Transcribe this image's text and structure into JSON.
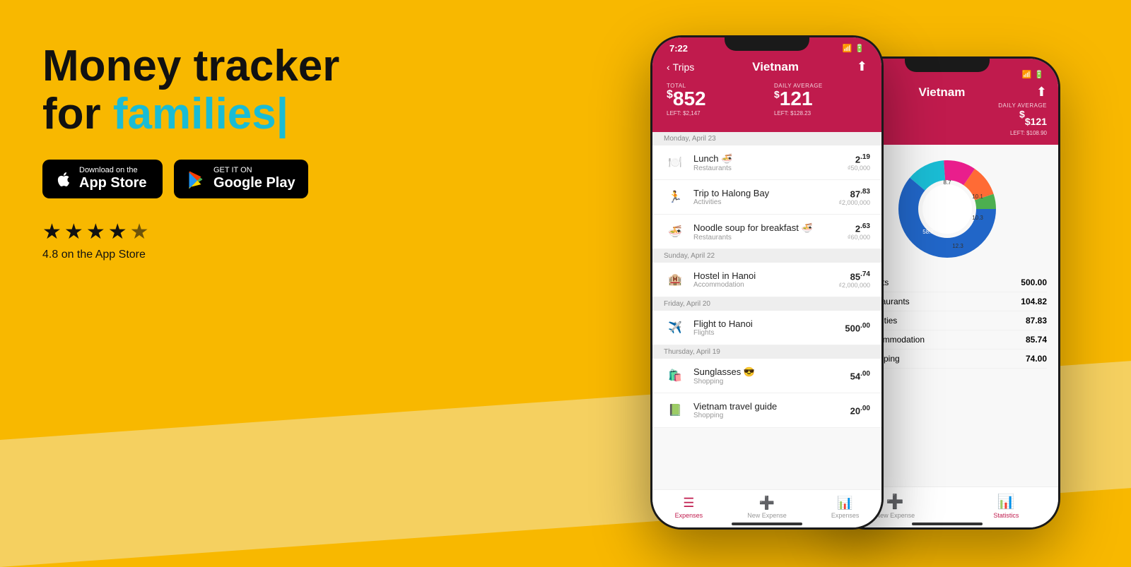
{
  "background_color": "#F8B800",
  "headline": {
    "line1": "Money tracker",
    "line2_prefix": "for ",
    "line2_highlight": "families",
    "cursor": "|"
  },
  "buttons": {
    "app_store": {
      "top_text": "Download on the",
      "main_text": "App Store"
    },
    "google_play": {
      "top_text": "GET IT ON",
      "main_text": "Google Play"
    }
  },
  "rating": {
    "stars": 4.8,
    "label": "4.8 on the App Store"
  },
  "phone_front": {
    "status_time": "7:22",
    "nav_back": "Trips",
    "nav_title": "Vietnam",
    "total_label": "TOTAL",
    "total_value": "$852",
    "total_left": "LEFT: $2,147",
    "daily_avg_label": "DAILY AVERAGE",
    "daily_avg_value": "$121",
    "daily_avg_left": "LEFT: $128.23",
    "sections": [
      {
        "date": "Monday, April 23",
        "items": [
          {
            "icon": "🍽️",
            "name": "Lunch 🍜",
            "category": "Restaurants",
            "amount": "2",
            "decimal": "19",
            "local": "₫50,000"
          },
          {
            "icon": "🏃",
            "name": "Trip to Halong Bay",
            "category": "Activities",
            "amount": "87",
            "decimal": "83",
            "local": "₫2,000,000"
          },
          {
            "icon": "🍜",
            "name": "Noodle soup for breakfast 🍜",
            "category": "Restaurants",
            "amount": "2",
            "decimal": "63",
            "local": "₫60,000"
          }
        ]
      },
      {
        "date": "Sunday, April 22",
        "items": [
          {
            "icon": "🏨",
            "name": "Hostel in Hanoi",
            "category": "Accommodation",
            "amount": "85",
            "decimal": "74",
            "local": "₫2,000,000"
          }
        ]
      },
      {
        "date": "Friday, April 20",
        "items": [
          {
            "icon": "✈️",
            "name": "Flight to Hanoi",
            "category": "Flights",
            "amount": "500",
            "decimal": "00",
            "local": ""
          }
        ]
      },
      {
        "date": "Thursday, April 19",
        "items": [
          {
            "icon": "🛍️",
            "name": "Sunglasses 😎",
            "category": "Shopping",
            "amount": "54",
            "decimal": "00",
            "local": ""
          },
          {
            "icon": "📗",
            "name": "Vietnam travel guide",
            "category": "Shopping",
            "amount": "20",
            "decimal": "00",
            "local": ""
          }
        ]
      }
    ],
    "tabs": [
      {
        "label": "Expenses",
        "active": true
      },
      {
        "label": "New Expense",
        "active": false
      },
      {
        "label": "Expenses",
        "active": false
      }
    ]
  },
  "phone_back": {
    "nav_title": "Vietnam",
    "daily_avg_label": "DAILY AVERAGE",
    "daily_avg_value": "$121",
    "daily_avg_left": "LEFT: $108.90",
    "chart": {
      "segments": [
        {
          "label": "Flights",
          "value": 500,
          "percent": 58.7,
          "color": "#2166C8"
        },
        {
          "label": "Restaurants",
          "value": 104.82,
          "percent": 12.3,
          "color": "#1ABCD4"
        },
        {
          "label": "Activities",
          "value": 87.83,
          "percent": 10.3,
          "color": "#E91E8C"
        },
        {
          "label": "Accommodation",
          "value": 85.74,
          "percent": 10.1,
          "color": "#FF6B35"
        },
        {
          "label": "Shopping",
          "value": 74,
          "percent": 8.7,
          "color": "#4CAF50"
        }
      ]
    },
    "legend": [
      {
        "label": "Flights",
        "amount": "500.00",
        "color": "#2166C8"
      },
      {
        "label": "Restaurants",
        "amount": "104.82",
        "color": "#1ABCD4"
      },
      {
        "label": "Activities",
        "amount": "87.83",
        "color": "#E91E8C"
      },
      {
        "label": "Accommodation",
        "amount": "85.74",
        "color": "#FF6B35"
      },
      {
        "label": "Shopping",
        "amount": "74.00",
        "color": "#4CAF50"
      }
    ],
    "tabs": [
      {
        "label": "New Expense",
        "active": false
      },
      {
        "label": "Statistics",
        "active": true
      }
    ]
  }
}
